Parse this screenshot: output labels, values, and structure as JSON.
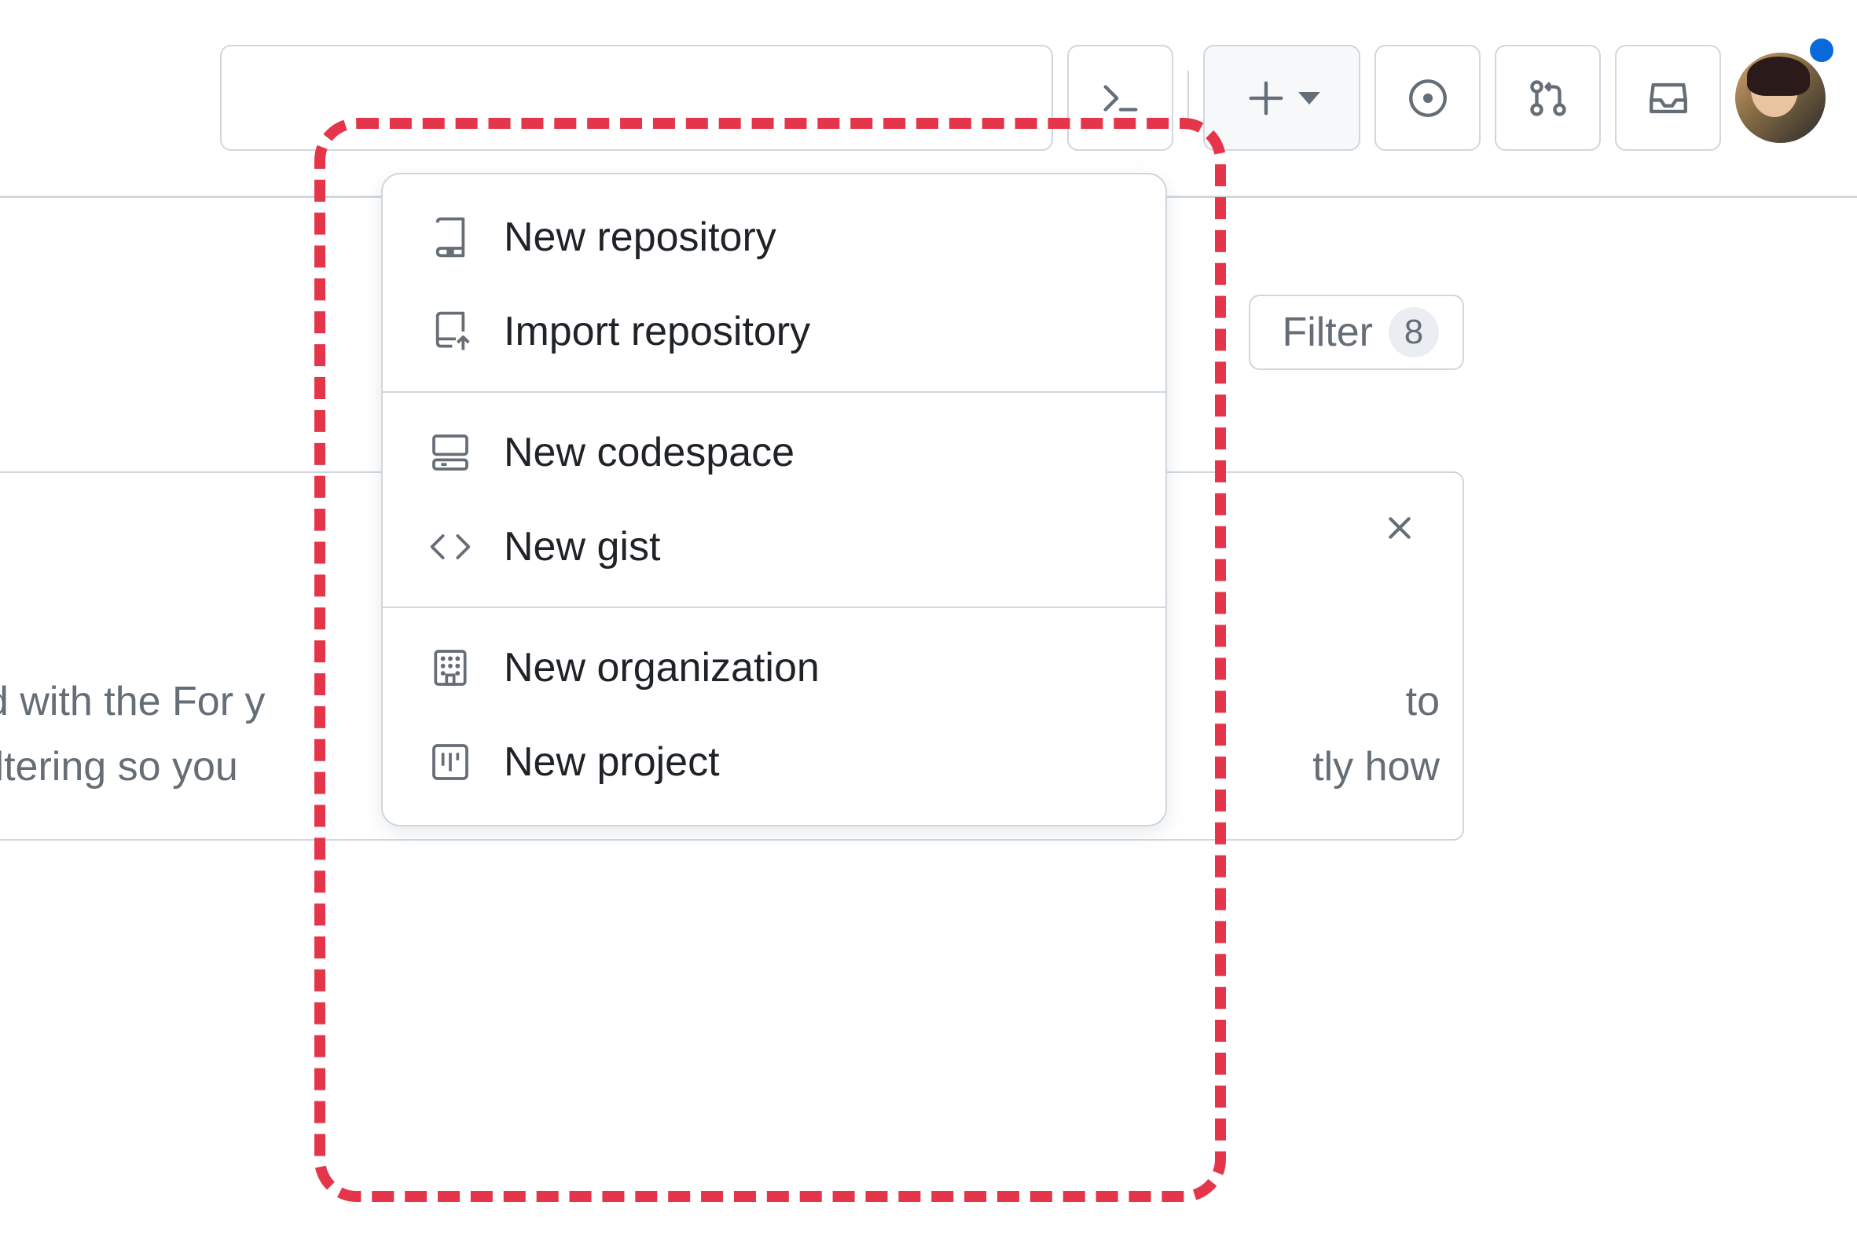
{
  "header": {
    "toolbar": {
      "command_palette_icon": "command-palette",
      "create_icon": "plus",
      "issues_icon": "issue-opened",
      "pull_requests_icon": "git-pull-request",
      "inbox_icon": "inbox"
    },
    "avatar": {
      "has_notification": true
    }
  },
  "filter": {
    "label": "Filter",
    "count": "8"
  },
  "panel": {
    "body_line1": "d with the For y",
    "body_line2": "iltering so you",
    "body_frag1": "to",
    "body_frag2": "tly how"
  },
  "dropdown": {
    "groups": [
      {
        "items": [
          {
            "icon": "repo",
            "label": "New repository"
          },
          {
            "icon": "repo-push",
            "label": "Import repository"
          }
        ]
      },
      {
        "items": [
          {
            "icon": "codespaces",
            "label": "New codespace"
          },
          {
            "icon": "code",
            "label": "New gist"
          }
        ]
      },
      {
        "items": [
          {
            "icon": "organization",
            "label": "New organization"
          },
          {
            "icon": "project",
            "label": "New project"
          }
        ]
      }
    ]
  },
  "colors": {
    "border": "#d0d7de",
    "text": "#1f2328",
    "muted": "#656d76",
    "highlight": "#e5354b",
    "accent": "#0969da",
    "bg_subtle": "#f6f8fa"
  }
}
